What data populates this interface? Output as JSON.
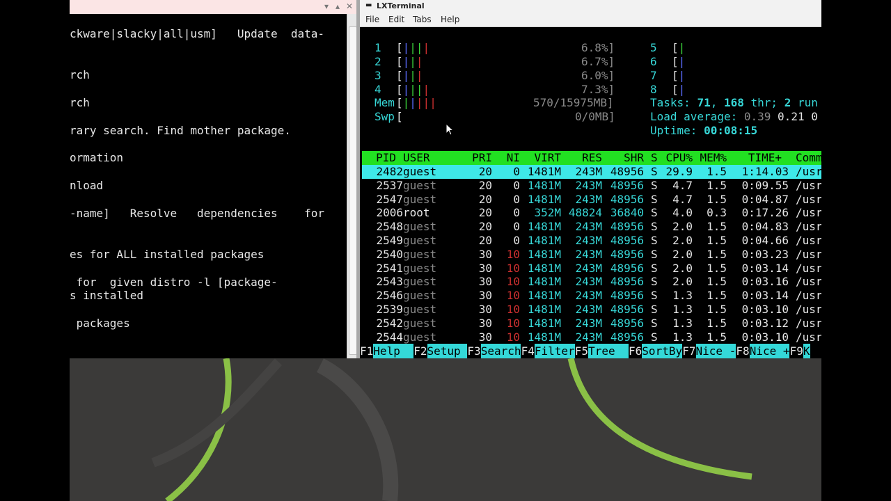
{
  "left_terminal": {
    "window_controls": [
      "▾",
      "▴",
      "✕"
    ],
    "lines": [
      "ckware|slacky|all|usm]   Update  data-",
      "rch",
      "rch",
      "rary search. Find mother package.",
      "ormation",
      "nload",
      "-name]   Resolve   dependencies    for",
      "es for ALL installed packages",
      " for  given distro -l [package-",
      "s installed",
      " packages"
    ]
  },
  "right_terminal": {
    "title": "LXTerminal",
    "menu": [
      "File",
      "Edit",
      "Tabs",
      "Help"
    ],
    "meters": {
      "cpus_left": [
        {
          "num": "1",
          "pct": "6.8%]"
        },
        {
          "num": "2",
          "pct": "6.7%]"
        },
        {
          "num": "3",
          "pct": "6.0%]"
        },
        {
          "num": "4",
          "pct": "7.3%]"
        }
      ],
      "cpus_right": [
        "5",
        "6",
        "7",
        "8"
      ],
      "mem_label": "Mem",
      "mem_value": "570/15975MB]",
      "swp_label": "Swp",
      "swp_value": "0/0MB]",
      "tasks_label": "Tasks:",
      "tasks_count": "71",
      "threads": "168",
      "threads_label": "thr;",
      "running": "2",
      "running_label": "run",
      "load_label": "Load average:",
      "load1": "0.39",
      "load5": "0.21",
      "load15": "0",
      "uptime_label": "Uptime:",
      "uptime": "00:08:15"
    },
    "table": {
      "headers": [
        "PID",
        "USER",
        "PRI",
        "NI",
        "VIRT",
        "RES",
        "SHR",
        "S",
        "CPU%",
        "MEM%",
        "TIME+",
        "Comm"
      ],
      "rows": [
        {
          "pid": "2482",
          "user": "guest",
          "pri": "20",
          "ni": "0",
          "virt": "1481M",
          "res": "243M",
          "shr": "48956",
          "s": "S",
          "cpu": "29.9",
          "mem": "1.5",
          "time": "1:14.03",
          "cmd": "/usr"
        },
        {
          "pid": "2537",
          "user": "guest",
          "pri": "20",
          "ni": "0",
          "virt": "1481M",
          "res": "243M",
          "shr": "48956",
          "s": "S",
          "cpu": "4.7",
          "mem": "1.5",
          "time": "0:09.55",
          "cmd": "/usr"
        },
        {
          "pid": "2547",
          "user": "guest",
          "pri": "20",
          "ni": "0",
          "virt": "1481M",
          "res": "243M",
          "shr": "48956",
          "s": "S",
          "cpu": "4.7",
          "mem": "1.5",
          "time": "0:04.87",
          "cmd": "/usr"
        },
        {
          "pid": "2006",
          "user": "root",
          "pri": "20",
          "ni": "0",
          "virt": "352M",
          "res": "48824",
          "shr": "36840",
          "s": "S",
          "cpu": "4.0",
          "mem": "0.3",
          "time": "0:17.26",
          "cmd": "/usr"
        },
        {
          "pid": "2548",
          "user": "guest",
          "pri": "20",
          "ni": "0",
          "virt": "1481M",
          "res": "243M",
          "shr": "48956",
          "s": "S",
          "cpu": "2.0",
          "mem": "1.5",
          "time": "0:04.83",
          "cmd": "/usr"
        },
        {
          "pid": "2549",
          "user": "guest",
          "pri": "20",
          "ni": "0",
          "virt": "1481M",
          "res": "243M",
          "shr": "48956",
          "s": "S",
          "cpu": "2.0",
          "mem": "1.5",
          "time": "0:04.66",
          "cmd": "/usr"
        },
        {
          "pid": "2540",
          "user": "guest",
          "pri": "30",
          "ni": "10",
          "virt": "1481M",
          "res": "243M",
          "shr": "48956",
          "s": "S",
          "cpu": "2.0",
          "mem": "1.5",
          "time": "0:03.23",
          "cmd": "/usr"
        },
        {
          "pid": "2541",
          "user": "guest",
          "pri": "30",
          "ni": "10",
          "virt": "1481M",
          "res": "243M",
          "shr": "48956",
          "s": "S",
          "cpu": "2.0",
          "mem": "1.5",
          "time": "0:03.14",
          "cmd": "/usr"
        },
        {
          "pid": "2543",
          "user": "guest",
          "pri": "30",
          "ni": "10",
          "virt": "1481M",
          "res": "243M",
          "shr": "48956",
          "s": "S",
          "cpu": "2.0",
          "mem": "1.5",
          "time": "0:03.16",
          "cmd": "/usr"
        },
        {
          "pid": "2546",
          "user": "guest",
          "pri": "30",
          "ni": "10",
          "virt": "1481M",
          "res": "243M",
          "shr": "48956",
          "s": "S",
          "cpu": "1.3",
          "mem": "1.5",
          "time": "0:03.14",
          "cmd": "/usr"
        },
        {
          "pid": "2539",
          "user": "guest",
          "pri": "30",
          "ni": "10",
          "virt": "1481M",
          "res": "243M",
          "shr": "48956",
          "s": "S",
          "cpu": "1.3",
          "mem": "1.5",
          "time": "0:03.10",
          "cmd": "/usr"
        },
        {
          "pid": "2542",
          "user": "guest",
          "pri": "30",
          "ni": "10",
          "virt": "1481M",
          "res": "243M",
          "shr": "48956",
          "s": "S",
          "cpu": "1.3",
          "mem": "1.5",
          "time": "0:03.12",
          "cmd": "/usr"
        },
        {
          "pid": "2544",
          "user": "guest",
          "pri": "30",
          "ni": "10",
          "virt": "1481M",
          "res": "243M",
          "shr": "48956",
          "s": "S",
          "cpu": "1.3",
          "mem": "1.5",
          "time": "0:03.10",
          "cmd": "/usr"
        }
      ]
    },
    "function_keys": [
      {
        "key": "F1",
        "label": "Help  "
      },
      {
        "key": "F2",
        "label": "Setup "
      },
      {
        "key": "F3",
        "label": "Search"
      },
      {
        "key": "F4",
        "label": "Filter"
      },
      {
        "key": "F5",
        "label": "Tree  "
      },
      {
        "key": "F6",
        "label": "SortBy"
      },
      {
        "key": "F7",
        "label": "Nice -"
      },
      {
        "key": "F8",
        "label": "Nice +"
      },
      {
        "key": "F9",
        "label": "K"
      }
    ]
  },
  "colors": {
    "header_bar": "#22e022",
    "selected_row": "#3ee8e8",
    "desktop": "#3b3a39",
    "desktop_swoosh": "#8ac046"
  }
}
